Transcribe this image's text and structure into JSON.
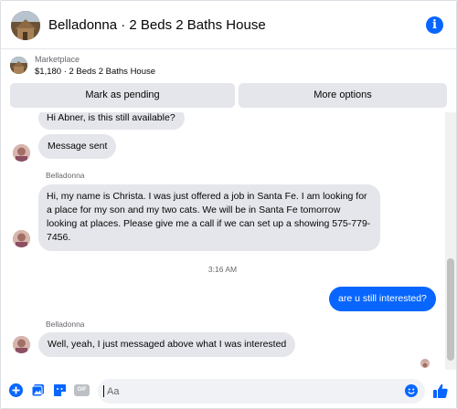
{
  "header": {
    "title": "Belladonna · 2 Beds 2 Baths House",
    "info_icon": "info-icon"
  },
  "marketplace": {
    "label": "Marketplace",
    "listing": "$1,180 · 2 Beds 2 Baths House",
    "mark_pending_label": "Mark as pending",
    "more_options_label": "More options"
  },
  "conversation": {
    "msg_partial": "Hi Abner, is this still available?",
    "msg_sent": "Message sent",
    "sender_1": "Belladonna",
    "msg_long": "Hi, my name is Christa. I was just offered a job in Santa Fe. I am looking for a place for my son and my two cats. We will be in Santa Fe tomorrow looking at places. Please give me a call if we can set up a showing 575-779-7456.",
    "timestamp": "3:16 AM",
    "msg_out": "are u still interested?",
    "sender_2": "Belladonna",
    "msg_reply": "Well, yeah, I just messaged above what I was interested"
  },
  "composer": {
    "placeholder": "Aa",
    "icons": [
      "plus-icon",
      "photo-icon",
      "sticker-icon",
      "gif-icon",
      "emoji-icon",
      "thumbs-up-icon"
    ],
    "gif_label": "GIF"
  },
  "colors": {
    "accent": "#0866ff",
    "bubble_gray": "#e4e6eb",
    "secondary_text": "#65676b"
  }
}
